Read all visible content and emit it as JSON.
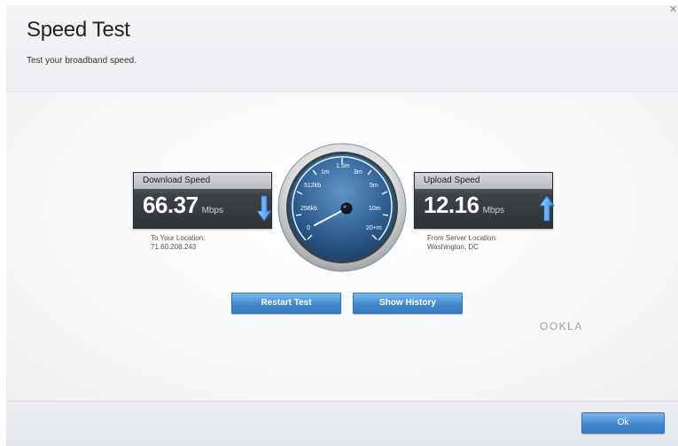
{
  "header": {
    "title": "Speed Test",
    "subtitle": "Test your broadband speed."
  },
  "download": {
    "label": "Download Speed",
    "value": "66.37",
    "unit": "Mbps",
    "location_label": "To Your Location:",
    "location_value": "71.60.208.243"
  },
  "upload": {
    "label": "Upload Speed",
    "value": "12.16",
    "unit": "Mbps",
    "location_label": "From Server Location:",
    "location_value": "Washington, DC"
  },
  "gauge": {
    "ticks": [
      "0",
      "256kb",
      "512kb",
      "1m",
      "1.5m",
      "3m",
      "5m",
      "10m",
      "20+m"
    ]
  },
  "buttons": {
    "restart": "Restart Test",
    "history": "Show History",
    "ok": "Ok"
  },
  "branding": {
    "logo": "OOKLA"
  },
  "colors": {
    "accent": "#3f86cd",
    "panel": "#3a3e42"
  }
}
